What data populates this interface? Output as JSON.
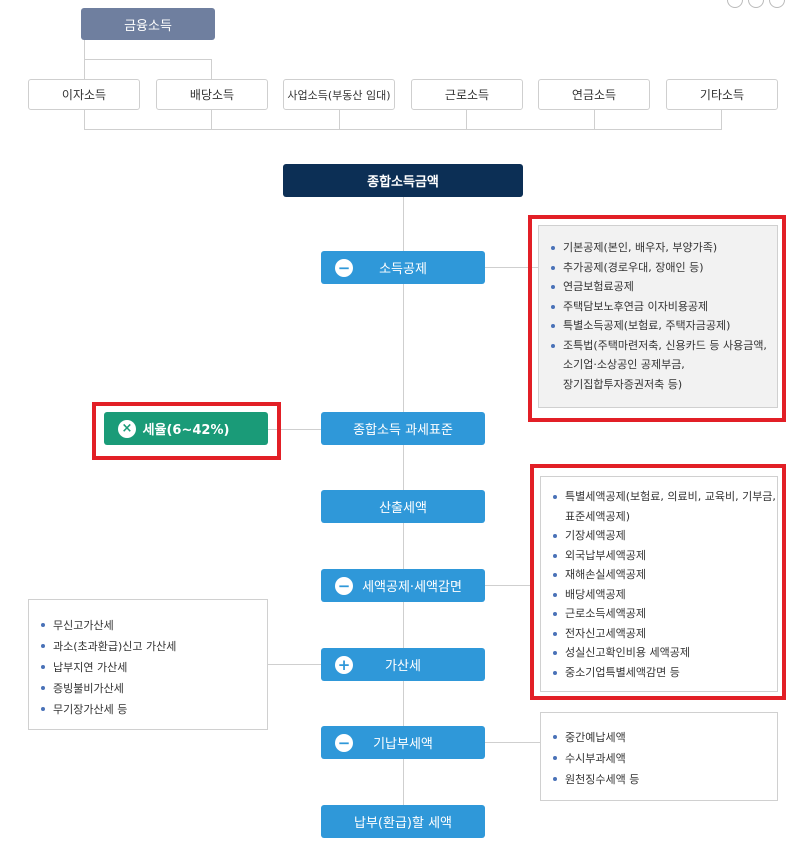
{
  "top_box": "금융소득",
  "incomes": [
    "이자소득",
    "배당소득",
    "사업소득(부동산 임대)",
    "근로소득",
    "연금소득",
    "기타소득"
  ],
  "flow": {
    "total_income": "종합소득금액",
    "deduction": "소득공제",
    "tax_base": "종합소득 과세표준",
    "tax_rate": "세율(6~42%)",
    "calc_tax": "산출세액",
    "tax_credit": "세액공제·세액감면",
    "surcharge": "가산세",
    "prepaid": "기납부세액",
    "final": "납부(환급)할 세액"
  },
  "deduction_items": [
    "기본공제(본인, 배우자, 부양가족)",
    "추가공제(경로우대, 장애인 등)",
    "연금보험료공제",
    "주택담보노후연금 이자비용공제",
    "특별소득공제(보험료, 주택자금공제)",
    "조특법(주택마련저축, 신용카드 등 사용금액,",
    "소기업·소상공인 공제부금,",
    "장기집합투자증권저축 등)"
  ],
  "credit_items": [
    "특별세액공제(보험료, 의료비, 교육비, 기부금,",
    "표준세액공제)",
    "기장세액공제",
    "외국납부세액공제",
    "재해손실세액공제",
    "배당세액공제",
    "근로소득세액공제",
    "전자신고세액공제",
    "성실신고확인비용 세액공제",
    "중소기업특별세액감면 등"
  ],
  "surcharge_items": [
    "무신고가산세",
    "과소(초과환급)신고 가산세",
    "납부지연 가산세",
    "증빙불비가산세",
    "무기장가산세 등"
  ],
  "prepaid_items": [
    "중간예납세액",
    "수시부과세액",
    "원천징수세액 등"
  ],
  "icons": {
    "minus": "−",
    "plus": "+",
    "times": "×"
  },
  "colors": {
    "navy": "#0c2f55",
    "blue": "#2f98d9",
    "green": "#1a9b78",
    "slate": "#6f7f9f",
    "highlight": "#e21f26"
  }
}
